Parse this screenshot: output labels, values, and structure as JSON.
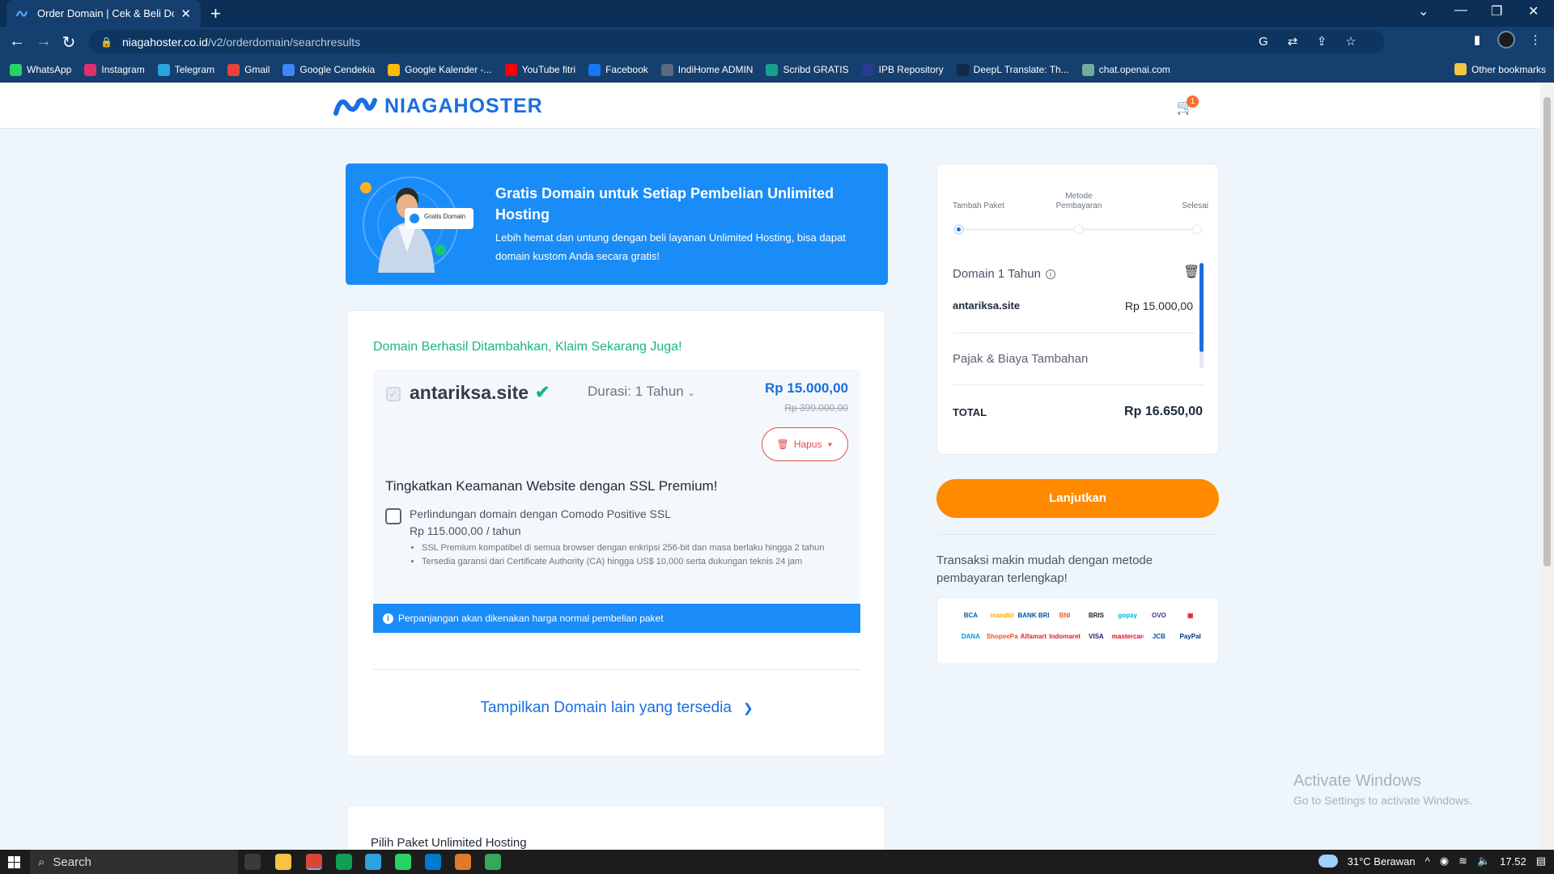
{
  "browser": {
    "tab_title": "Order Domain | Cek & Beli Doma",
    "new_tab": "+",
    "url_host": "niagahoster.co.id",
    "url_path": "/v2/orderdomain/searchresults",
    "bookmarks": [
      {
        "label": "WhatsApp",
        "color": "#25d366"
      },
      {
        "label": "Instagram",
        "color": "#e1306c"
      },
      {
        "label": "Telegram",
        "color": "#2aa3e0"
      },
      {
        "label": "Gmail",
        "color": "#ea4335"
      },
      {
        "label": "Google Cendekia",
        "color": "#4285f4"
      },
      {
        "label": "Google Kalender -...",
        "color": "#fbbc05"
      },
      {
        "label": "YouTube fitri",
        "color": "#ff0000"
      },
      {
        "label": "Facebook",
        "color": "#1877f2"
      },
      {
        "label": "IndiHome ADMIN",
        "color": "#5b6b7d"
      },
      {
        "label": "Scribd GRATIS",
        "color": "#1a9e8f"
      },
      {
        "label": "IPB Repository",
        "color": "#2b3a8c"
      },
      {
        "label": "DeepL Translate: Th...",
        "color": "#0f2b46"
      },
      {
        "label": "chat.openai.com",
        "color": "#74aa9c"
      }
    ],
    "other_bookmarks": "Other bookmarks"
  },
  "header": {
    "logo_text": "NIAGAHOSTER",
    "cart_count": "1"
  },
  "promo": {
    "badge_text": "Gratis Domain",
    "title": "Gratis Domain untuk Setiap Pembelian Unlimited Hosting",
    "description": "Lebih hemat dan untung dengan beli layanan Unlimited Hosting, bisa dapat domain kustom Anda secara gratis!"
  },
  "domain_card": {
    "heading": "Domain Berhasil Ditambahkan, Klaim Sekarang Juga!",
    "domain": "antariksa.site",
    "duration": "Durasi: 1 Tahun",
    "price": "Rp 15.000,00",
    "old_price": "Rp 399.000,00",
    "remove_label": "Hapus",
    "ssl_title": "Tingkatkan Keamanan Website dengan SSL Premium!",
    "ssl_option": "Perlindungan domain dengan Comodo Positive SSL",
    "ssl_price": "Rp 115.000,00 / tahun",
    "ssl_features": [
      "SSL Premium kompatibel di semua browser dengan enkripsi 256-bit dan masa berlaku hingga 2 tahun",
      "Tersedia garansi dari Certificate Authority (CA) hingga US$ 10,000 serta dukungan teknis 24 jam"
    ],
    "info_notice": "Perpanjangan akan dikenakan harga normal pembelian paket",
    "show_more": "Tampilkan Domain lain yang tersedia"
  },
  "hosting_card": {
    "title": "Pilih Paket Unlimited Hosting"
  },
  "summary": {
    "steps": [
      "Tambah Paket",
      "Metode Pembayaran",
      "Selesai"
    ],
    "item_title": "Domain 1 Tahun",
    "item_domain": "antariksa.site",
    "item_price": "Rp 15.000,00",
    "tax_label": "Pajak & Biaya Tambahan",
    "total_label": "TOTAL",
    "total_value": "Rp 16.650,00"
  },
  "checkout": {
    "button": "Lanjutkan",
    "payment_text": "Transaksi makin mudah dengan metode pembayaran terlengkap!",
    "payment_methods": [
      {
        "label": "BCA",
        "color": "#0060af"
      },
      {
        "label": "mandiri",
        "color": "#f5a400"
      },
      {
        "label": "BANK BRI",
        "color": "#00529c"
      },
      {
        "label": "BNI",
        "color": "#f15a23"
      },
      {
        "label": "BRIS",
        "color": "#1d1d1b"
      },
      {
        "label": "gopay",
        "color": "#00aed6"
      },
      {
        "label": "OVO",
        "color": "#4c3494"
      },
      {
        "label": "▣",
        "color": "#e31e24"
      },
      {
        "label": "DANA",
        "color": "#118ee9"
      },
      {
        "label": "ShopeePay",
        "color": "#ee4d2d"
      },
      {
        "label": "Alfamart",
        "color": "#e2231a"
      },
      {
        "label": "Indomaret",
        "color": "#e31e24"
      },
      {
        "label": "VISA",
        "color": "#1a1f71"
      },
      {
        "label": "mastercard",
        "color": "#eb001b"
      },
      {
        "label": "JCB",
        "color": "#0b4ea2"
      },
      {
        "label": "PayPal",
        "color": "#003087"
      }
    ]
  },
  "watermark": {
    "line1": "Activate Windows",
    "line2": "Go to Settings to activate Windows."
  },
  "taskbar": {
    "search": "Search",
    "weather": "31°C  Berawan",
    "time": "17.52"
  },
  "colors": {
    "brand_blue": "#1a6ee0",
    "cta_orange": "#ff8a00",
    "success_green": "#18b58a",
    "danger_red": "#e24b4b"
  }
}
